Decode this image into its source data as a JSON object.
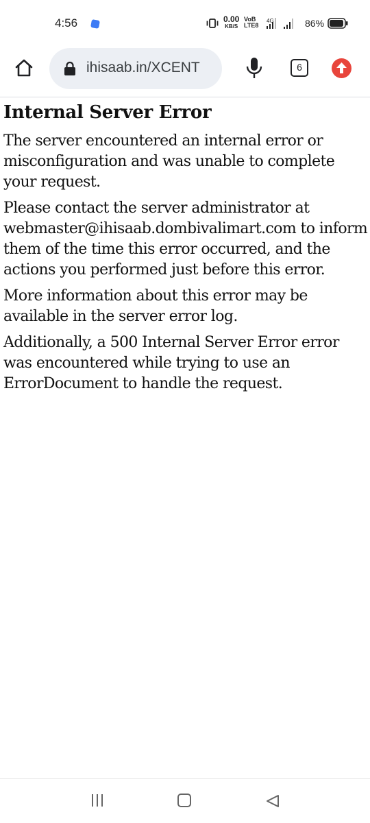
{
  "status_bar": {
    "time": "4:56",
    "net_speed_value": "0.00",
    "net_speed_unit": "KB/S",
    "volte_top": "VoB",
    "volte_bottom": "LTE8",
    "network": "4G",
    "battery": "86%",
    "icons": [
      "vibrate-icon",
      "signal-icon",
      "battery-icon"
    ],
    "notification_color": "#3d7bf5"
  },
  "toolbar": {
    "url": "ihisaab.in/XCENT",
    "tab_count": "6",
    "icons": [
      "home-icon",
      "lock-icon",
      "mic-icon",
      "update-icon"
    ],
    "update_badge_color": "#e8453c"
  },
  "page": {
    "title": "Internal Server Error",
    "paragraphs": [
      "The server encountered an internal error or misconfiguration and was unable to complete your request.",
      "Please contact the server administrator at webmaster@ihisaab.dombivalimart.com to inform them of the time this error occurred, and the actions you performed just before this error.",
      "More information about this error may be available in the server error log.",
      "Additionally, a 500 Internal Server Error error was encountered while trying to use an ErrorDocument to handle the request."
    ]
  },
  "nav_bar": {
    "icons": [
      "recents-icon",
      "home-square-icon",
      "back-icon"
    ]
  }
}
